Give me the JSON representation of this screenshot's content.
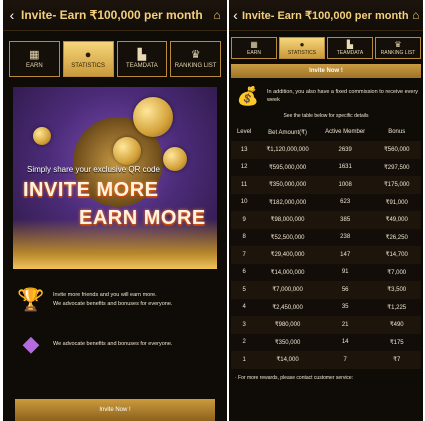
{
  "left": {
    "header": {
      "title": "Invite- Earn ₹100,000 per month",
      "back_icon": "chevron-left",
      "home_icon": "home"
    },
    "tabs": [
      {
        "label": "EARN",
        "icon": "qr-icon",
        "active": false
      },
      {
        "label": "STATISTICS",
        "icon": "money-bag-icon",
        "active": true
      },
      {
        "label": "TEAMDATA",
        "icon": "bar-chart-icon",
        "active": false
      },
      {
        "label": "RANKING LIST",
        "icon": "crown-icon",
        "active": false
      }
    ],
    "banner": {
      "subtitle": "Simply share your exclusive QR code",
      "line1": "INVITE MORE",
      "line2": "EARN MORE"
    },
    "features": [
      {
        "icon": "trophy-icon",
        "lines": [
          "Invite more friends and you will earn more.",
          "We advocate benefits and bonuses for everyone."
        ]
      },
      {
        "icon": "gem-icon",
        "lines": [
          "We advocate benefits and bonuses for everyone."
        ]
      }
    ],
    "invite_button": "Invite Now !"
  },
  "right": {
    "header": {
      "title": "Invite- Earn ₹100,000 per month",
      "back_icon": "chevron-left",
      "home_icon": "home"
    },
    "tabs": [
      {
        "label": "EARN",
        "icon": "qr-icon",
        "active": false
      },
      {
        "label": "STATISTICS",
        "icon": "money-bag-icon",
        "active": true
      },
      {
        "label": "TEAMDATA",
        "icon": "bar-chart-icon",
        "active": false
      },
      {
        "label": "RANKING LIST",
        "icon": "crown-icon",
        "active": false
      }
    ],
    "invite_button": "Invite Now !",
    "info_text": "In addition, you also have a fixed commission to receive every week",
    "see_table": "See the table below for specific details",
    "table": {
      "headers": [
        "Level",
        "Bet Amount(₹)",
        "Active Member",
        "Bonus"
      ],
      "rows": [
        [
          "13",
          "₹1,120,000,000",
          "2639",
          "₹560,000"
        ],
        [
          "12",
          "₹595,000,000",
          "1631",
          "₹297,500"
        ],
        [
          "11",
          "₹350,000,000",
          "1008",
          "₹175,000"
        ],
        [
          "10",
          "₹182,000,000",
          "623",
          "₹91,000"
        ],
        [
          "9",
          "₹98,000,000",
          "385",
          "₹49,000"
        ],
        [
          "8",
          "₹52,500,000",
          "238",
          "₹26,250"
        ],
        [
          "7",
          "₹29,400,000",
          "147",
          "₹14,700"
        ],
        [
          "6",
          "₹14,000,000",
          "91",
          "₹7,000"
        ],
        [
          "5",
          "₹7,000,000",
          "56",
          "₹3,500"
        ],
        [
          "4",
          "₹2,450,000",
          "35",
          "₹1,225"
        ],
        [
          "3",
          "₹980,000",
          "21",
          "₹490"
        ],
        [
          "2",
          "₹350,000",
          "14",
          "₹175"
        ],
        [
          "1",
          "₹14,000",
          "7",
          "₹7"
        ]
      ]
    },
    "footer_text": "· For more rewards, please contact customer service:"
  },
  "colors": {
    "gold": "#f3cf7a",
    "background": "#0f0b07",
    "accent": "#c99b42"
  }
}
